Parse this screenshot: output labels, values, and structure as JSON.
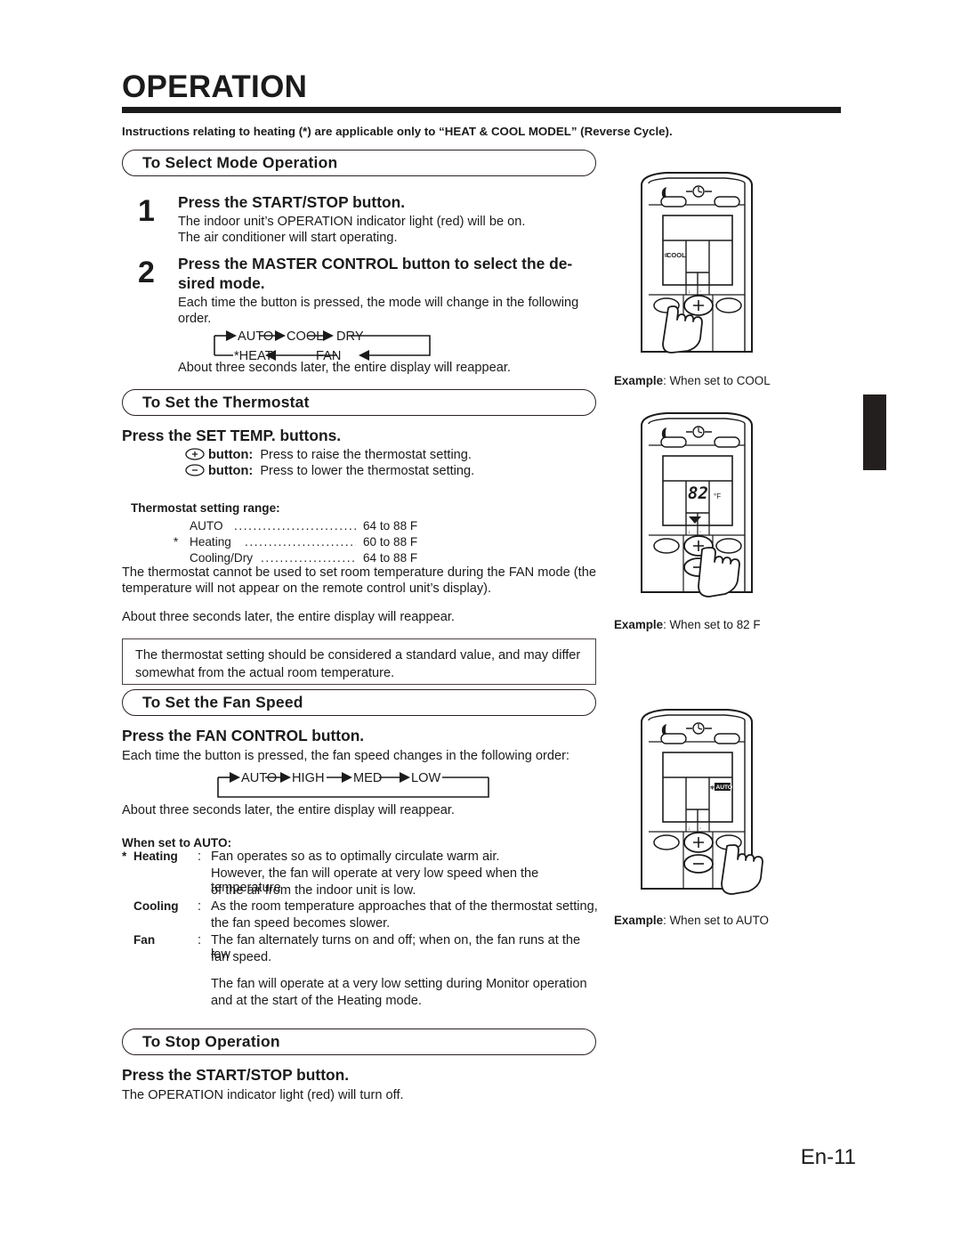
{
  "document": {
    "title": "OPERATION",
    "lead": "Instructions relating to heating (*) are applicable only to “HEAT & COOL MODEL” (Reverse Cycle).",
    "page_number": "En-11"
  },
  "sections": {
    "select_mode": {
      "banner": "To Select Mode Operation",
      "step1": {
        "number": "1",
        "heading": "Press the START/STOP button.",
        "line1": "The indoor unit’s OPERATION indicator light (red) will be on.",
        "line2": "The air conditioner will start operating."
      },
      "step2": {
        "number": "2",
        "heading_line1": "Press the MASTER CONTROL button to select the de-",
        "heading_line2": "sired mode.",
        "line1": "Each time the button is pressed, the mode will change in the following",
        "line2": "order.",
        "cycle": [
          "AUTO",
          "COOL",
          "DRY",
          "FAN",
          "*HEAT"
        ],
        "footer": "About three seconds later, the entire display will reappear."
      }
    },
    "thermostat": {
      "banner": "To Set the Thermostat",
      "heading": "Press the SET TEMP. buttons.",
      "buttons": [
        {
          "icon": "plus-button-icon",
          "label": "button:",
          "text": "Press to raise the thermostat setting."
        },
        {
          "icon": "minus-button-icon",
          "label": "button:",
          "text": "Press to lower the thermostat setting."
        }
      ],
      "range_title": "Thermostat setting range:",
      "ranges": [
        {
          "star": "",
          "mode": "AUTO",
          "value": "64 to 88  F"
        },
        {
          "star": "*",
          "mode": "Heating",
          "value": "60 to 88  F"
        },
        {
          "star": "",
          "mode": "Cooling/Dry",
          "value": "64 to 88  F"
        }
      ],
      "note_line1": "The thermostat cannot be used to set room temperature during the FAN mode (the",
      "note_line2": "temperature will not appear on the remote control unit’s display).",
      "footer": "About three seconds later, the entire display will reappear.",
      "box_line1": "The thermostat setting should be considered a standard value, and may differ",
      "box_line2": "somewhat from the actual room temperature."
    },
    "fan_speed": {
      "banner": "To Set the Fan Speed",
      "heading": "Press the FAN CONTROL button.",
      "intro": "Each time the button is pressed, the fan speed changes in the following order:",
      "cycle": [
        "AUTO",
        "HIGH",
        "MED",
        "LOW"
      ],
      "footer": "About three seconds later, the entire display will reappear.",
      "auto_title": "When set to AUTO:",
      "rows": [
        {
          "star": "*",
          "label": "Heating",
          "colon": ":",
          "lines": [
            "Fan operates so as to optimally circulate warm air.",
            "However, the fan will operate at very low speed when the temperature",
            "of the air from the indoor unit is low."
          ]
        },
        {
          "star": "",
          "label": "Cooling",
          "colon": ":",
          "lines": [
            "As the room temperature approaches that of the thermostat setting,",
            "the fan speed becomes slower."
          ]
        },
        {
          "star": "",
          "label": "Fan",
          "colon": ":",
          "lines": [
            "The fan alternately turns on and off; when on, the fan runs at the low",
            "fan speed."
          ]
        }
      ],
      "tail_line1": "The fan will operate at a very low setting during Monitor operation",
      "tail_line2": "and at the start of the Heating mode."
    },
    "stop": {
      "banner": "To Stop Operation",
      "heading": "Press the START/STOP button.",
      "line1": "The OPERATION indicator light (red) will turn off."
    }
  },
  "illustrations": [
    {
      "name": "remote-cool",
      "display_mode": "COOL",
      "caption_label": "Example",
      "caption_text": ": When set to COOL"
    },
    {
      "name": "remote-temp",
      "display_temp": "82",
      "display_unit": "F",
      "caption_label": "Example",
      "caption_text": ": When set to 82  F"
    },
    {
      "name": "remote-auto",
      "display_fan": "AUTO",
      "caption_label": "Example",
      "caption_text": ": When set to AUTO"
    }
  ],
  "colors": {
    "ink": "#1b1b1b",
    "rule": "#2a2020",
    "tab": "#231f1f"
  }
}
